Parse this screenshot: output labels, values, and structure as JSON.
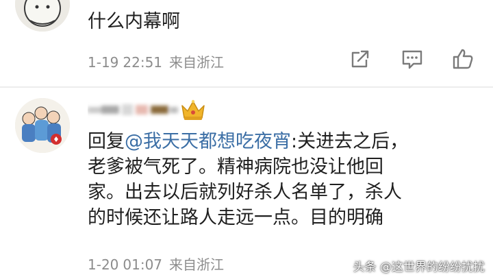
{
  "comments": [
    {
      "text": "什么内幕啊",
      "date": "1-19",
      "time": "22:51",
      "source": "来自浙江",
      "actions": {
        "share_icon": "share-icon",
        "comment_icon": "comment-icon",
        "like_icon": "thumbs-up-icon"
      }
    },
    {
      "reply_prefix": "回复",
      "mention": "@我天天都想吃夜宵",
      "separator": ":",
      "line1_rest": "关进去之后，",
      "line2": "老爹被气死了。精神病院也没让他回",
      "line3": "家。出去以后就列好杀人名单了，杀人",
      "line4": "的时候还让路人走远一点。目的明确",
      "date": "1-20",
      "time": "01:07",
      "source": "来自浙江"
    }
  ],
  "watermark": "头条 @这世界的纷纷扰扰",
  "colors": {
    "mention": "#3b6ea5",
    "meta": "#8c8c8c",
    "text": "#1f1f1f",
    "crown": "#e0a020"
  }
}
